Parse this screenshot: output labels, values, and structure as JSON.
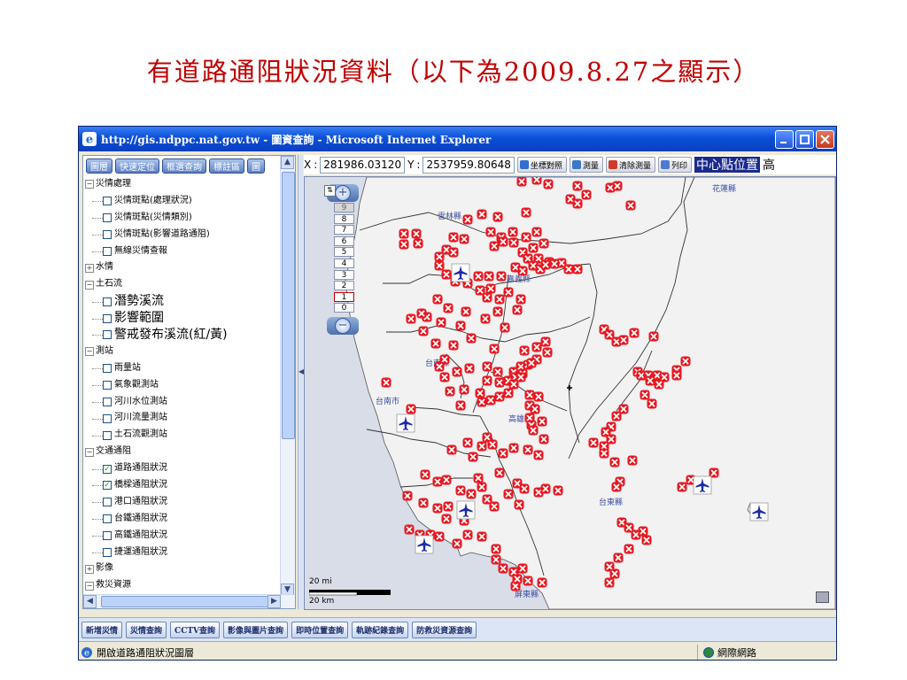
{
  "slide": {
    "title": "有道路通阻狀況資料（以下為2009.8.27之顯示）"
  },
  "window": {
    "title": "http://gis.ndppc.nat.gov.tw - 圖資查詢 - Microsoft Internet Explorer"
  },
  "toolbar": {
    "buttons": [
      "圖層",
      "快速定位",
      "框選查詢",
      "標註區",
      "圖"
    ]
  },
  "tree": [
    {
      "type": "group",
      "label": "災情處理",
      "expanded": true
    },
    {
      "type": "item",
      "label": "災情斑點(處理狀況)",
      "checked": false
    },
    {
      "type": "item",
      "label": "災情斑點(災情類別)",
      "checked": false
    },
    {
      "type": "item",
      "label": "災情斑點(影響道路通阻)",
      "checked": false
    },
    {
      "type": "item",
      "label": "無線災情查報",
      "checked": false
    },
    {
      "type": "group",
      "label": "水情",
      "expanded": false
    },
    {
      "type": "group",
      "label": "土石流",
      "expanded": true
    },
    {
      "type": "item",
      "label": "潛勢溪流",
      "checked": false,
      "big": true
    },
    {
      "type": "item",
      "label": "影響範圍",
      "checked": false,
      "big": true
    },
    {
      "type": "item",
      "label": "警戒發布溪流(紅/黃)",
      "checked": false,
      "big": true
    },
    {
      "type": "group",
      "label": "測站",
      "expanded": true
    },
    {
      "type": "item",
      "label": "雨量站",
      "checked": false
    },
    {
      "type": "item",
      "label": "氣象觀測站",
      "checked": false
    },
    {
      "type": "item",
      "label": "河川水位測站",
      "checked": false
    },
    {
      "type": "item",
      "label": "河川流量測站",
      "checked": false
    },
    {
      "type": "item",
      "label": "土石流觀測站",
      "checked": false
    },
    {
      "type": "group",
      "label": "交通通阻",
      "expanded": true
    },
    {
      "type": "item",
      "label": "道路通阻狀況",
      "checked": true
    },
    {
      "type": "item",
      "label": "橋樑通阻狀況",
      "checked": true
    },
    {
      "type": "item",
      "label": "港口通阻狀況",
      "checked": false
    },
    {
      "type": "item",
      "label": "台鐵通阻狀況",
      "checked": false
    },
    {
      "type": "item",
      "label": "高鐵通阻狀況",
      "checked": false
    },
    {
      "type": "item",
      "label": "捷運通阻狀況",
      "checked": false
    },
    {
      "type": "group",
      "label": "影像",
      "expanded": false
    },
    {
      "type": "group",
      "label": "救災資源",
      "expanded": true
    }
  ],
  "coords": {
    "x_label": "X",
    "x_value": "281986.03120",
    "y_label": "Y",
    "y_value": "2537959.80648",
    "buttons": [
      "坐標對照",
      "測量",
      "清除測量",
      "列印"
    ],
    "button_colors": [
      "#2f6fd0",
      "#3a78c8",
      "#d03a2a",
      "#4c7bd1"
    ],
    "center_label": "中心點位置",
    "extra_label": "高"
  },
  "zoom": {
    "levels": [
      "9",
      "8",
      "7",
      "6",
      "5",
      "4",
      "3",
      "2",
      "1",
      "0"
    ],
    "active": "9",
    "current": "1",
    "corner": "⇅"
  },
  "scale": {
    "miles": "20 mi",
    "km": "20 km"
  },
  "map": {
    "labels": [
      {
        "id": "label-hualien",
        "text": "花蓮縣"
      },
      {
        "id": "label-yunlin",
        "text": "雲林縣"
      },
      {
        "id": "label-chiayi",
        "text": "嘉義縣"
      },
      {
        "id": "label-tainan-county",
        "text": "台南縣"
      },
      {
        "id": "label-tainan-city",
        "text": "台南市"
      },
      {
        "id": "label-kaohsiung",
        "text": "高雄縣"
      },
      {
        "id": "label-taitung",
        "text": "台東縣"
      },
      {
        "id": "label-pingtung",
        "text": "屏東縣"
      }
    ],
    "marker_color": "#e8161f",
    "land_color": "#f2f2f2",
    "sea_color": "#d9dde7",
    "airport_icon": "airplane-icon",
    "closure_icon": "road-closed-x-icon"
  },
  "bottom_tabs": [
    "新增災情",
    "災情查詢",
    "CCTV查詢",
    "影像與圖片查詢",
    "即時位置查詢",
    "軌跡紀錄查詢",
    "防救災資源查詢"
  ],
  "status": {
    "left": "開啟道路通阻狀況圖層",
    "right": "網際網路"
  }
}
